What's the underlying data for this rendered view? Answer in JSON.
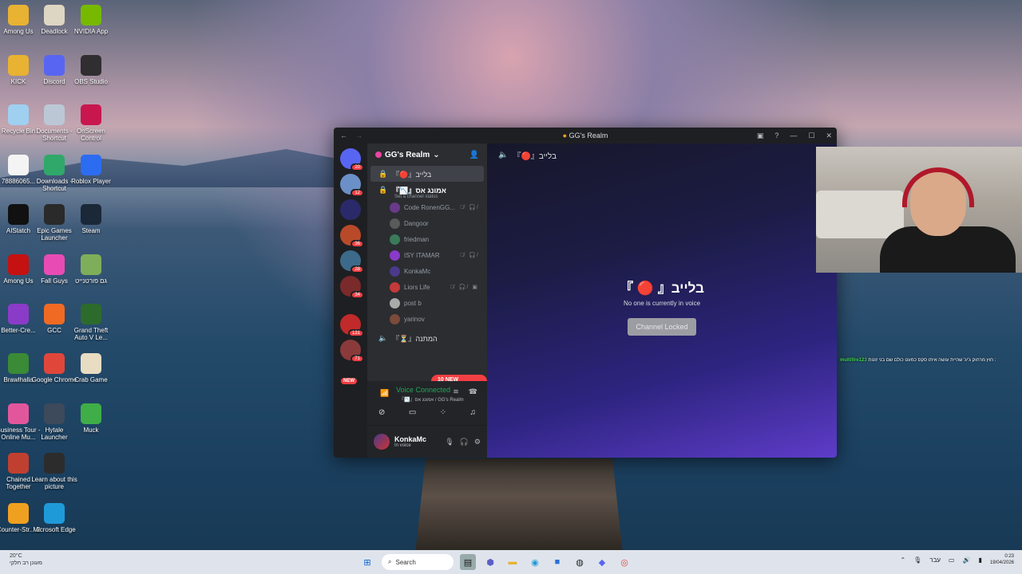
{
  "desktop_icons": [
    {
      "label": "Among Us",
      "icon": "among-us-folder-icon",
      "color": "#e8b233"
    },
    {
      "label": "Deadlock",
      "icon": "deadlock-icon",
      "color": "#ddd6c2"
    },
    {
      "label": "NVIDIA App",
      "icon": "nvidia-icon",
      "color": "#76b900"
    },
    {
      "label": "KICK",
      "icon": "kick-icon",
      "color": "#e8b233"
    },
    {
      "label": "Discord",
      "icon": "discord-icon",
      "color": "#5865f2"
    },
    {
      "label": "OBS Studio",
      "icon": "obs-icon",
      "color": "#302e31"
    },
    {
      "label": "Recycle Bin",
      "icon": "recycle-bin-icon",
      "color": "#9fd0f0"
    },
    {
      "label": "Documents - Shortcut",
      "icon": "documents-icon",
      "color": "#bcc7d6"
    },
    {
      "label": "OnScreen Control",
      "icon": "onscreen-control-icon",
      "color": "#c8174e"
    },
    {
      "label": "78886065...",
      "icon": "file-icon",
      "color": "#f4f4f4"
    },
    {
      "label": "Downloads - Shortcut",
      "icon": "downloads-icon",
      "color": "#2fa86a"
    },
    {
      "label": "Roblox Player",
      "icon": "roblox-icon",
      "color": "#2c6cf0"
    },
    {
      "label": "AIStatch",
      "icon": "aistatch-icon",
      "color": "#111111"
    },
    {
      "label": "Epic Games Launcher",
      "icon": "epic-games-icon",
      "color": "#2a2a2a"
    },
    {
      "label": "Steam",
      "icon": "steam-icon",
      "color": "#1b2838"
    },
    {
      "label": "Among Us",
      "icon": "among-us-icon",
      "color": "#c51111"
    },
    {
      "label": "Fall Guys",
      "icon": "fall-guys-icon",
      "color": "#e94bb4"
    },
    {
      "label": "גם פורטנייט",
      "icon": "game-folder-icon",
      "color": "#7fae5a"
    },
    {
      "label": "Better-Cre...",
      "icon": "better-crewlink-icon",
      "color": "#8a3cc8"
    },
    {
      "label": "GCC",
      "icon": "gcc-icon",
      "color": "#f06a24"
    },
    {
      "label": "Grand Theft Auto V Le...",
      "icon": "gta-v-icon",
      "color": "#2d6b2d"
    },
    {
      "label": "Brawlhalla",
      "icon": "brawlhalla-icon",
      "color": "#3a8a36"
    },
    {
      "label": "Google Chrome",
      "icon": "chrome-icon",
      "color": "#e0463a"
    },
    {
      "label": "Crab Game",
      "icon": "crab-game-icon",
      "color": "#e8dcc2"
    },
    {
      "label": "Business Tour - Online Mu...",
      "icon": "business-tour-icon",
      "color": "#e2579c"
    },
    {
      "label": "Hytale Launcher",
      "icon": "hytale-icon",
      "color": "#3c4a5c"
    },
    {
      "label": "Muck",
      "icon": "muck-icon",
      "color": "#3fae48"
    },
    {
      "label": "Chained Together",
      "icon": "chained-together-icon",
      "color": "#c04030"
    },
    {
      "label": "Learn about this picture",
      "icon": "learn-picture-icon",
      "color": "#2c2c2c"
    },
    {
      "label": "Counter-Str... 2",
      "icon": "counter-strike-icon",
      "color": "#f0a020"
    },
    {
      "label": "Microsoft Edge",
      "icon": "edge-icon",
      "color": "#1f9ad8"
    }
  ],
  "window": {
    "title": "GG's Realm",
    "server_name": "GG's Realm",
    "channels": [
      {
        "name": "『🔴』בלייב",
        "locked": true,
        "selected": true
      },
      {
        "name": "『📉』אמונג אס",
        "locked": true,
        "selected": false,
        "status": "Set a channel status"
      }
    ],
    "members": [
      {
        "name": "Code RonenGG...",
        "icons": "🎙̸ 🎧̸"
      },
      {
        "name": "Dangoor",
        "icons": ""
      },
      {
        "name": "friedman",
        "icons": ""
      },
      {
        "name": "ISY ITAMAR",
        "icons": "🎙̸ 🎧̸"
      },
      {
        "name": "KonkaMc",
        "icons": ""
      },
      {
        "name": "Liors Life",
        "icons": "🎙̸ 🎧̸ ▣"
      },
      {
        "name": "post b",
        "icons": ""
      },
      {
        "name": "yarinov",
        "icons": ""
      }
    ],
    "extra_channel": "『⏳』המתנה",
    "mentions_label": "10 NEW MENTIONS",
    "new_badge": "NEW",
    "server_badges": [
      "20",
      "12",
      "",
      "36",
      "28",
      "34",
      "",
      "131",
      "71"
    ],
    "voice": {
      "status": "Voice Connected",
      "location": "『📉』אמונג אס / GG's Realm"
    },
    "user": {
      "name": "KonkaMc",
      "status": "In voice"
    },
    "channel_header": "『🔴』בלייב",
    "main_title": "『 🔴 』בלייב",
    "main_sub": "No one is currently in voice",
    "locked_label": "Channel Locked",
    "category_text": "חולקיבות"
  },
  "chat_overlay": {
    "user": "multifire123",
    "message": "חוץ מרחוק ג'יג' שהיית עושה איתו סקס כמעט כולם שם בני זונות :"
  },
  "taskbar": {
    "weather_temp": "20°C",
    "weather_desc": "מעונן רב חלקי",
    "search_placeholder": "Search",
    "language": "עבר",
    "time": "0:23",
    "date": "19/04/2026"
  }
}
